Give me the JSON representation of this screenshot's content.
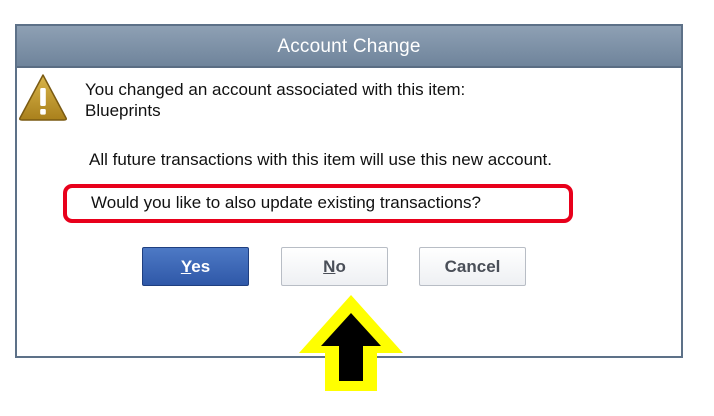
{
  "dialog": {
    "title": "Account Change",
    "icon": "warning-icon",
    "message_line1": "You changed an account associated with this item:",
    "item_name": "Blueprints",
    "message_line2": "All future transactions with this item will use this new account.",
    "question": "Would you like to also update existing transactions?",
    "highlight_color": "#e8001b"
  },
  "buttons": {
    "yes": {
      "mnemonic": "Y",
      "rest": "es"
    },
    "no": {
      "mnemonic": "N",
      "rest": "o"
    },
    "cancel": {
      "label": "Cancel"
    }
  },
  "annotation": {
    "arrow_icon": "up-arrow-icon",
    "arrow_fill": "#ffff00",
    "arrow_inner": "#000000"
  }
}
